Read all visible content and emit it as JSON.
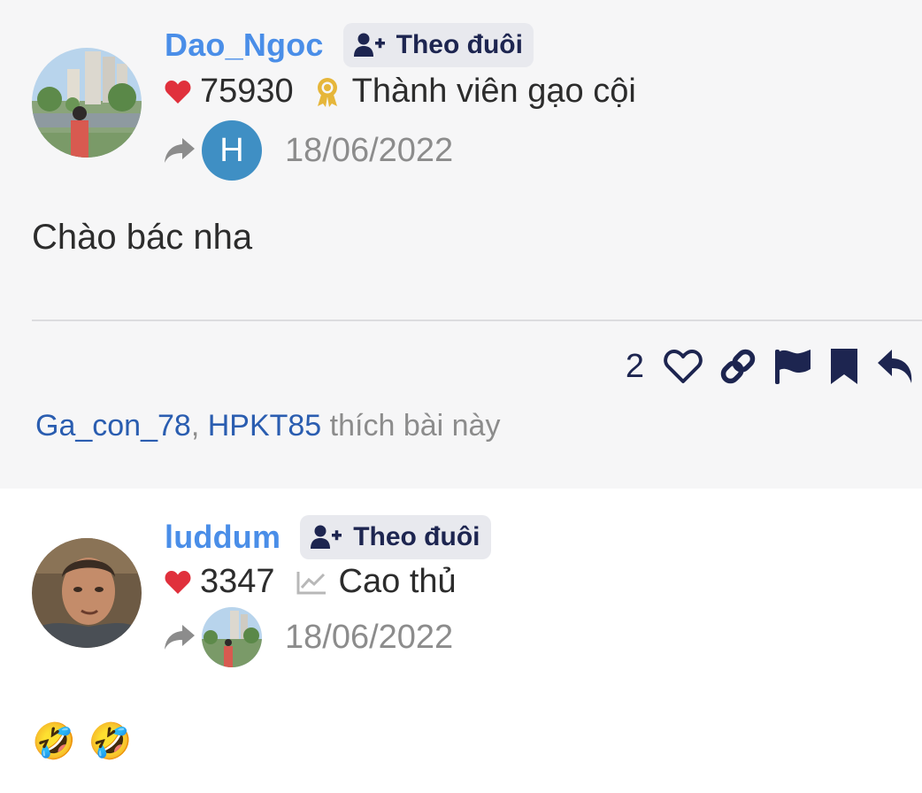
{
  "posts": [
    {
      "author": "Dao_Ngoc",
      "follow_label": "Theo đuôi",
      "reactions": "75930",
      "rank": "Thành viên gạo cội",
      "reply_to_initial": "H",
      "date": "18/06/2022",
      "content": "Chào bác nha",
      "like_count": "2",
      "likers": [
        "Ga_con_78",
        "HPKT85"
      ],
      "likers_separator": ",",
      "likers_suffix": "thích bài này"
    },
    {
      "author": "luddum",
      "follow_label": "Theo đuôi",
      "reactions": "3347",
      "rank": "Cao thủ",
      "date": "18/06/2022",
      "content_emojis": [
        "🤣",
        "🤣"
      ]
    }
  ],
  "colors": {
    "username": "#4a8ee8",
    "heart": "#e0303c",
    "badge_gold": "#e6b63a",
    "navy": "#1d2550",
    "liker_link": "#2a5db0"
  }
}
